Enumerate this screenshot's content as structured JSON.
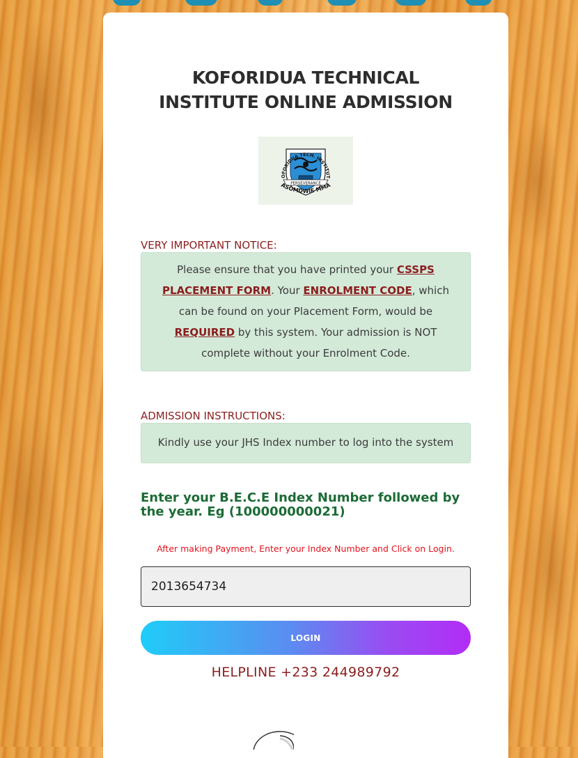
{
  "header": {
    "title_line1": "KOFORIDUA TECHNICAL",
    "title_line2": "INSTITUTE ONLINE ADMISSION"
  },
  "logo": {
    "arc_text": "KOFORIDUA TECH. INSTITUTE",
    "ribbon_text": "PERSEVERANCE",
    "motto": "ASOMDWIE MMA"
  },
  "notice": {
    "label": "VERY IMPORTANT NOTICE:",
    "t1": "Please ensure that you have printed your ",
    "link1": "CSSPS PLACEMENT FORM",
    "t2": ". Your ",
    "link2": "ENROLMENT CODE",
    "t3": ", which can be found on your Placement Form, would be ",
    "link3": "REQUIRED",
    "t4": " by this system. Your admission is NOT complete without your Enrolment Code."
  },
  "instructions": {
    "label": "ADMISSION INSTRUCTIONS:",
    "text": "Kindly use your JHS Index number to log into the system"
  },
  "form": {
    "bece_label": "Enter your B.E.C.E Index Number followed by the year. Eg (100000000021)",
    "payment_note": "After making Payment, Enter your Index Number and Click on Login.",
    "index_value": "2013654734",
    "login_label": "LOGIN",
    "helpline": "HELPLINE +233 244989792"
  },
  "colors": {
    "card_background": "#ffffff",
    "notice_label": "#8b1e1e",
    "notice_box": "#d4ead9",
    "bece_label": "#1c6b36",
    "payment_note": "#e0121c",
    "button_gradient_start": "#1fcdf8",
    "button_gradient_end": "#b32cf7",
    "page_background": "#e79634"
  }
}
